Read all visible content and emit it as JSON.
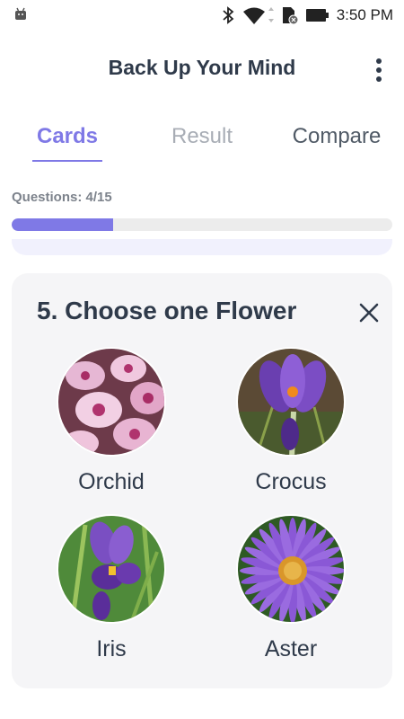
{
  "status_bar": {
    "time": "3:50 PM",
    "icons": [
      "android-debug-icon",
      "bluetooth-icon",
      "wifi-icon",
      "sd-card-icon",
      "battery-icon"
    ]
  },
  "app_bar": {
    "title": "Back Up Your Mind",
    "menu_icon": "more-vert-icon"
  },
  "tabs": [
    {
      "label": "Cards",
      "active": true
    },
    {
      "label": "Result",
      "active": false
    },
    {
      "label": "Compare",
      "active": false
    }
  ],
  "progress": {
    "label": "Questions: 4/15",
    "current": 4,
    "total": 15,
    "fraction": 0.2667
  },
  "question": {
    "title": "5. Choose one Flower",
    "close_icon": "close-icon",
    "options": [
      {
        "label": "Orchid",
        "image": "orchid-photo"
      },
      {
        "label": "Crocus",
        "image": "crocus-photo"
      },
      {
        "label": "Iris",
        "image": "iris-photo"
      },
      {
        "label": "Aster",
        "image": "aster-photo"
      }
    ]
  },
  "colors": {
    "accent": "#7f79e6",
    "text_dark": "#2f3a4a",
    "tab_inactive": "#a8adb5",
    "card_bg": "#f5f5f7",
    "track": "#ececec"
  }
}
